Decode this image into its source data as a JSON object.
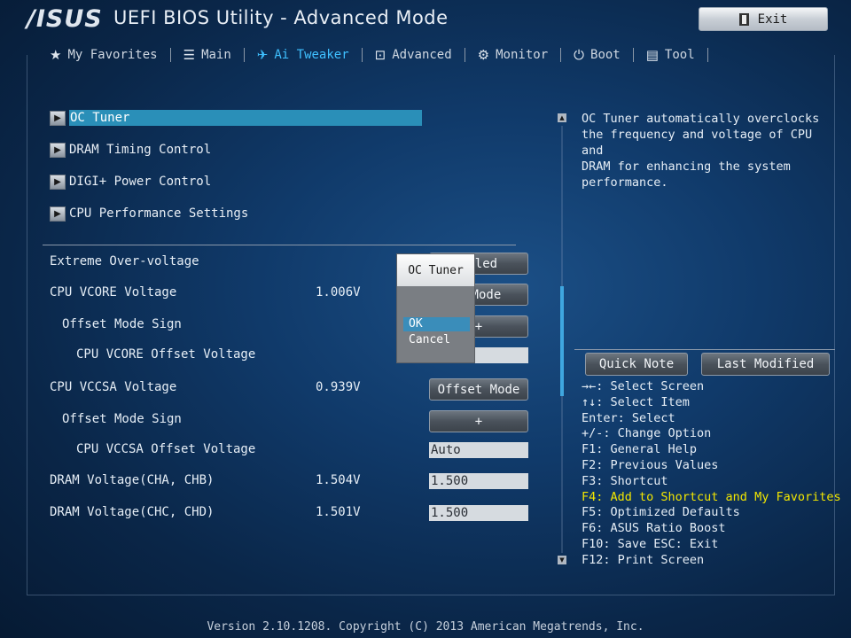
{
  "header": {
    "logo": "/ISUS",
    "title": "UEFI BIOS Utility - Advanced Mode",
    "exit_label": "Exit"
  },
  "tabs": [
    {
      "label": "My Favorites",
      "icon": "star-icon"
    },
    {
      "label": "Main",
      "icon": "list-icon"
    },
    {
      "label": "Ai Tweaker",
      "icon": "ai-tweaker-icon",
      "active": true
    },
    {
      "label": "Advanced",
      "icon": "advanced-icon"
    },
    {
      "label": "Monitor",
      "icon": "monitor-icon"
    },
    {
      "label": "Boot",
      "icon": "power-icon"
    },
    {
      "label": "Tool",
      "icon": "tool-icon"
    }
  ],
  "menu": {
    "items": [
      {
        "label": "OC Tuner",
        "selected": true
      },
      {
        "label": "DRAM Timing Control"
      },
      {
        "label": "DIGI+ Power Control"
      },
      {
        "label": "CPU Performance Settings"
      }
    ]
  },
  "settings": {
    "extreme_ov": {
      "label": "Extreme Over-voltage",
      "control": "abled"
    },
    "cpu_vcore": {
      "label": "CPU VCORE Voltage",
      "value": "1.006V",
      "control": "t Mode"
    },
    "offset_sign_1": {
      "label": "Offset Mode Sign",
      "control": "+"
    },
    "cpu_vcore_offset": {
      "label": "CPU VCORE Offset Voltage"
    },
    "cpu_vccsa": {
      "label": "CPU VCCSA Voltage",
      "value": "0.939V",
      "control": "Offset Mode"
    },
    "offset_sign_2": {
      "label": "Offset Mode Sign",
      "control": "+"
    },
    "cpu_vccsa_offset": {
      "label": "CPU VCCSA Offset Voltage",
      "field": "Auto"
    },
    "dram_ab": {
      "label": "DRAM Voltage(CHA, CHB)",
      "value": "1.504V",
      "field": "1.500"
    },
    "dram_cd": {
      "label": "DRAM Voltage(CHC, CHD)",
      "value": "1.501V",
      "field": "1.500"
    }
  },
  "popup": {
    "title": "OC Tuner",
    "ok": "OK",
    "cancel": "Cancel"
  },
  "help": {
    "description": "OC Tuner automatically overclocks\nthe frequency and voltage of CPU and\nDRAM for enhancing the system\nperformance."
  },
  "panel": {
    "quick_note": "Quick Note",
    "last_modified": "Last Modified"
  },
  "shortcuts": [
    "→←: Select Screen",
    "↑↓: Select Item",
    "Enter: Select",
    "+/-: Change Option",
    "F1: General Help",
    "F2: Previous Values",
    "F3: Shortcut",
    "F4: Add to Shortcut and My Favorites",
    "F5: Optimized Defaults",
    "F6: ASUS Ratio Boost",
    "F10: Save  ESC: Exit",
    "F12: Print Screen"
  ],
  "highlight_color": "#f2e600",
  "accent_color": "#3fc0ff",
  "footer": "Version 2.10.1208. Copyright (C) 2013 American Megatrends, Inc."
}
